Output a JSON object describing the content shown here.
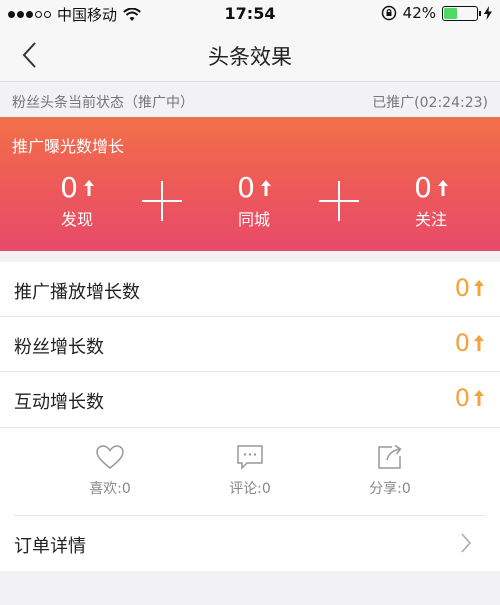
{
  "status_bar": {
    "carrier": "中国移动",
    "time": "17:54",
    "battery": "42%",
    "battery_level": 0.42
  },
  "nav": {
    "title": "头条效果"
  },
  "promo_status": {
    "label": "粉丝头条当前状态（推广中）",
    "elapsed": "已推广(02:24:23)"
  },
  "exposure": {
    "title": "推广曝光数增长",
    "items": [
      {
        "value": "0",
        "label": "发现"
      },
      {
        "value": "0",
        "label": "同城"
      },
      {
        "value": "0",
        "label": "关注"
      }
    ]
  },
  "growth_rows": [
    {
      "label": "推广播放增长数",
      "value": "0"
    },
    {
      "label": "粉丝增长数",
      "value": "0"
    },
    {
      "label": "互动增长数",
      "value": "0"
    }
  ],
  "actions": [
    {
      "icon": "heart-icon",
      "label": "喜欢:0"
    },
    {
      "icon": "comment-icon",
      "label": "评论:0"
    },
    {
      "icon": "share-icon",
      "label": "分享:0"
    }
  ],
  "order": {
    "label": "订单详情"
  },
  "colors": {
    "accent_orange": "#f5a23a",
    "gradient_top": "#f2704a",
    "gradient_bottom": "#e84a6a",
    "battery_green": "#4cd964"
  }
}
